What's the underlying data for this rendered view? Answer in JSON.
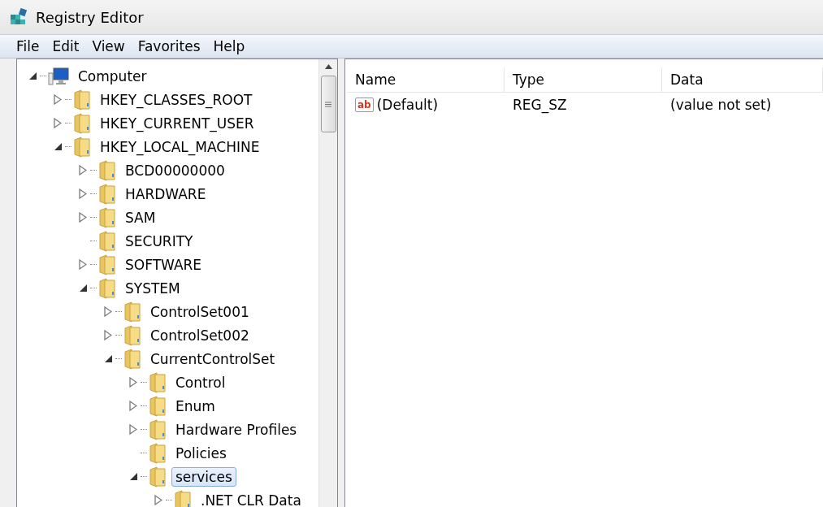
{
  "window": {
    "title": "Registry Editor"
  },
  "menu": [
    "File",
    "Edit",
    "View",
    "Favorites",
    "Help"
  ],
  "tree": [
    {
      "label": "Computer",
      "kind": "computer",
      "expanded": true,
      "selected": false,
      "children": [
        {
          "label": "HKEY_CLASSES_ROOT",
          "kind": "branch",
          "expanded": false,
          "selected": false
        },
        {
          "label": "HKEY_CURRENT_USER",
          "kind": "branch",
          "expanded": false,
          "selected": false
        },
        {
          "label": "HKEY_LOCAL_MACHINE",
          "kind": "branch",
          "expanded": true,
          "selected": false,
          "children": [
            {
              "label": "BCD00000000",
              "kind": "branch",
              "expanded": false,
              "selected": false
            },
            {
              "label": "HARDWARE",
              "kind": "branch",
              "expanded": false,
              "selected": false
            },
            {
              "label": "SAM",
              "kind": "branch",
              "expanded": false,
              "selected": false
            },
            {
              "label": "SECURITY",
              "kind": "leaf",
              "selected": false
            },
            {
              "label": "SOFTWARE",
              "kind": "branch",
              "expanded": false,
              "selected": false
            },
            {
              "label": "SYSTEM",
              "kind": "branch",
              "expanded": true,
              "selected": false,
              "children": [
                {
                  "label": "ControlSet001",
                  "kind": "branch",
                  "expanded": false,
                  "selected": false
                },
                {
                  "label": "ControlSet002",
                  "kind": "branch",
                  "expanded": false,
                  "selected": false
                },
                {
                  "label": "CurrentControlSet",
                  "kind": "branch",
                  "expanded": true,
                  "selected": false,
                  "children": [
                    {
                      "label": "Control",
                      "kind": "branch",
                      "expanded": false,
                      "selected": false
                    },
                    {
                      "label": "Enum",
                      "kind": "branch",
                      "expanded": false,
                      "selected": false
                    },
                    {
                      "label": "Hardware Profiles",
                      "kind": "branch",
                      "expanded": false,
                      "selected": false
                    },
                    {
                      "label": "Policies",
                      "kind": "leaf",
                      "selected": false
                    },
                    {
                      "label": "services",
                      "kind": "branch",
                      "expanded": true,
                      "selected": true,
                      "children": [
                        {
                          "label": ".NET CLR Data",
                          "kind": "branch",
                          "expanded": false,
                          "selected": false
                        }
                      ]
                    }
                  ]
                }
              ]
            }
          ]
        }
      ]
    }
  ],
  "values": {
    "columns": [
      "Name",
      "Type",
      "Data"
    ],
    "rows": [
      {
        "icon_text": "ab",
        "name": "(Default)",
        "type": "REG_SZ",
        "data": "(value not set)"
      }
    ]
  }
}
